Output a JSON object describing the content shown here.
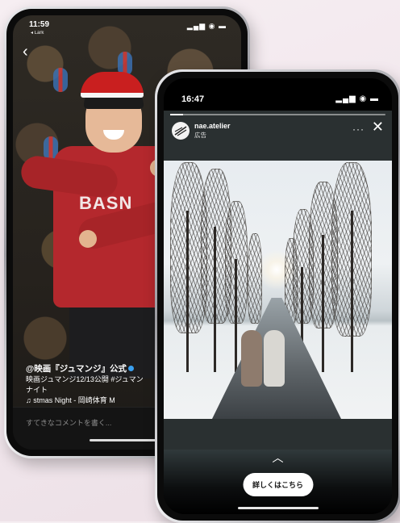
{
  "back_phone": {
    "status": {
      "time": "11:59",
      "sub": "◂ Lark",
      "signal": "▂▄▆ ◉ ▬"
    },
    "back_icon": "‹",
    "caption": {
      "handle": "@映画『ジュマンジ』公式",
      "line1": "映画ジュマンジ12/13公開 #ジュマン",
      "line2": "ナイト",
      "music": "♫  stmas Night - 岡崎体育  M"
    },
    "comment_placeholder": "すてきなコメントを書く..."
  },
  "front_phone": {
    "status": {
      "time": "16:47",
      "signal": "▂▄▆ ◉ ▬"
    },
    "account": {
      "name": "nae.atelier",
      "label": "広告"
    },
    "more_icon": "···",
    "close_icon": "✕",
    "chevron_icon": "︿",
    "cta_label": "詳しくはこちら"
  }
}
